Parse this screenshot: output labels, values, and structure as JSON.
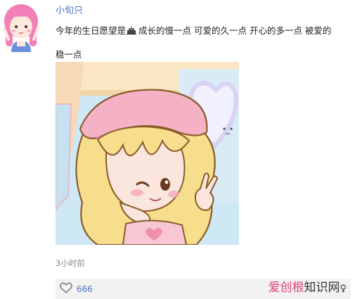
{
  "post": {
    "username": "小旬只",
    "text_before": "今年的生日愿望是",
    "emoji": "birthday-cake-icon",
    "text_after": "成长的慢一点 可爱的久一点 开心的多一点 被爱的稳一点",
    "timestamp": "3小时前"
  },
  "actions": {
    "like_icon": "heart-outline-icon",
    "like_count": "666"
  },
  "watermark": {
    "part1": "爱创根",
    "part2": "知识网",
    "part3": "♀"
  },
  "colors": {
    "username": "#4a76c8",
    "like_count": "#4a76c8",
    "action_bar_bg": "#f2f2f2",
    "watermark_pink": "#e0457a"
  }
}
